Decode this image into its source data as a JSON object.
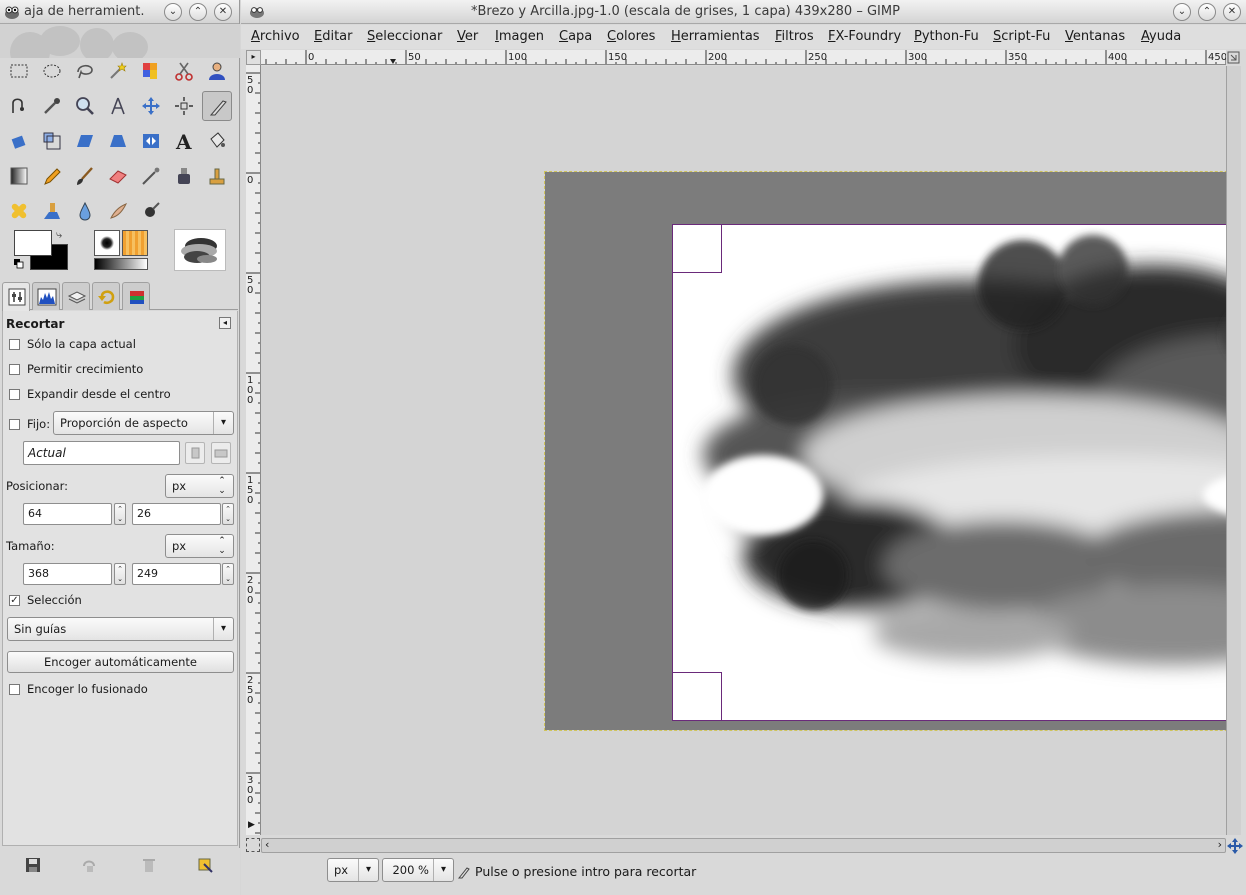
{
  "toolbox": {
    "title": "aja de herramient.",
    "options": {
      "title": "Recortar",
      "only_current_layer": "Sólo la capa actual",
      "allow_growing": "Permitir crecimiento",
      "expand_from_center": "Expandir desde el centro",
      "fixed_label": "Fijo:",
      "fixed_mode": "Proporción de aspecto",
      "fixed_value": "Actual",
      "position_label": "Posicionar:",
      "position_unit": "px",
      "position_x": "64",
      "position_y": "26",
      "size_label": "Tamaño:",
      "size_unit": "px",
      "size_w": "368",
      "size_h": "249",
      "highlight_label": "Selección",
      "highlight_checked": true,
      "guides": "Sin guías",
      "auto_shrink": "Encoger automáticamente",
      "shrink_merged": "Encoger lo fusionado"
    }
  },
  "image_window": {
    "title": "*Brezo y Arcilla.jpg-1.0 (escala de grises, 1 capa) 439x280 – GIMP",
    "menu": [
      "Archivo",
      "Editar",
      "Seleccionar",
      "Ver",
      "Imagen",
      "Capa",
      "Colores",
      "Herramientas",
      "Filtros",
      "FX-Foundry",
      "Python-Fu",
      "Script-Fu",
      "Ventanas",
      "Ayuda"
    ],
    "hruler_labels": [
      "0",
      "50",
      "100",
      "150",
      "200",
      "250",
      "300",
      "350",
      "400",
      "450"
    ],
    "vruler_labels": [
      "5\n0",
      "0",
      "5\n0",
      "1\n0\n0",
      "1\n5\n0",
      "2\n0\n0",
      "2\n5\n0",
      "3\n0\n0"
    ],
    "status": {
      "unit": "px",
      "zoom": "200 %",
      "message": "Pulse o presione intro para recortar"
    }
  }
}
